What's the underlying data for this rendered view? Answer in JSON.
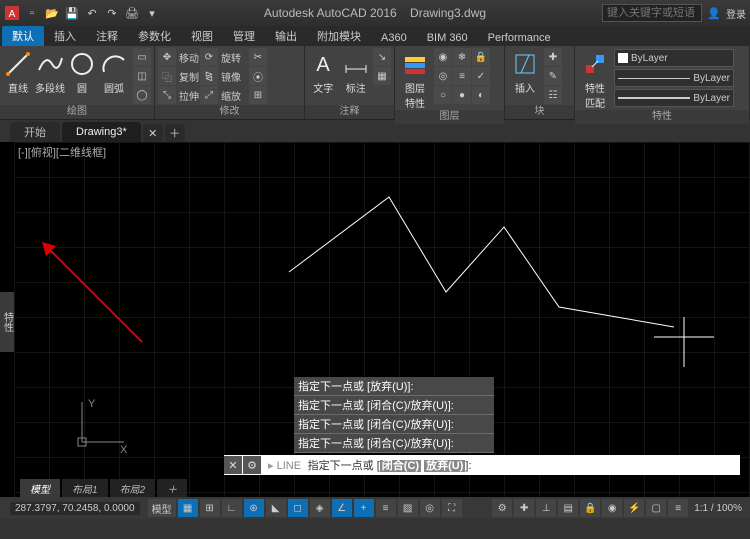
{
  "title": {
    "app": "Autodesk AutoCAD 2016",
    "doc": "Drawing3.dwg"
  },
  "search": {
    "placeholder": "键入关键字或短语"
  },
  "login": "登录",
  "tabs": [
    "默认",
    "插入",
    "注释",
    "参数化",
    "视图",
    "管理",
    "输出",
    "附加模块",
    "A360",
    "BIM 360",
    "Performance"
  ],
  "draw": {
    "line": "直线",
    "pline": "多段线",
    "circle": "圆",
    "arc": "圆弧",
    "title": "绘图"
  },
  "modify": {
    "move": "移动",
    "rotate": "旋转",
    "copy": "复制",
    "mirror": "镜像",
    "stretch": "拉伸",
    "scale": "缩放",
    "title": "修改"
  },
  "annot": {
    "text": "文字",
    "dim": "标注",
    "title": "注释"
  },
  "layer": {
    "props": "图层\n特性",
    "title": "图层"
  },
  "block": {
    "insert": "插入",
    "title": "块"
  },
  "props": {
    "match": "特性\n匹配",
    "title": "特性",
    "bylayer": "ByLayer"
  },
  "filetabs": {
    "start": "开始",
    "doc": "Drawing3*"
  },
  "view_ctrl": "[-][俯视][二维线框]",
  "sidebar": "特性",
  "history": [
    "指定下一点或 [放弃(U)]:",
    "指定下一点或 [闭合(C)/放弃(U)]:",
    "指定下一点或 [闭合(C)/放弃(U)]:",
    "指定下一点或 [闭合(C)/放弃(U)]:"
  ],
  "cmd": {
    "prefix": "LINE",
    "text": "指定下一点或 [",
    "op1": "闭合(C)",
    "sp": " ",
    "op2": "放弃(U)",
    "suffix": "]:"
  },
  "modeltabs": [
    "模型",
    "布局1",
    "布局2"
  ],
  "status": {
    "coord": "287.3797, 70.2458, 0.0000",
    "model": "模型",
    "zoom": "1:1 / 100%"
  }
}
